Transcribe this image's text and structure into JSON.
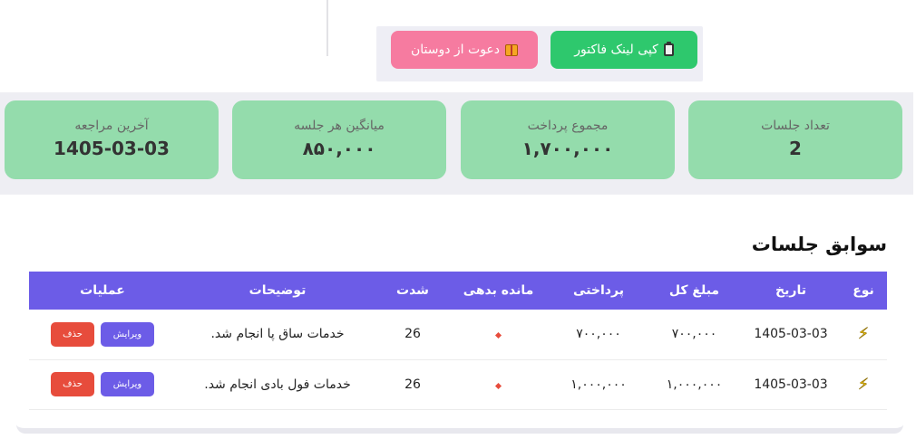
{
  "actions": {
    "copy_invoice_link": "کپی لینک فاکتور",
    "invite_friends": "دعوت از دوستان",
    "copy_icon": "clipboard-icon",
    "invite_icon": "gift-icon"
  },
  "stats": [
    {
      "label": "تعداد جلسات",
      "value": "2"
    },
    {
      "label": "مجموع پرداخت",
      "value": "۱,۷۰۰,۰۰۰"
    },
    {
      "label": "میانگین هر جلسه",
      "value": "۸۵۰,۰۰۰"
    },
    {
      "label": "آخرین مراجعه",
      "value": "1405-03-03"
    }
  ],
  "sessions": {
    "title": "سوابق جلسات",
    "columns": [
      "نوع",
      "تاریخ",
      "مبلغ کل",
      "پرداختی",
      "مانده بدهی",
      "شدت",
      "توضیحات",
      "عملیات"
    ],
    "rows": [
      {
        "type_icon": "lightning-icon",
        "date": "1405-03-03",
        "total": "۷۰۰,۰۰۰",
        "paid": "۷۰۰,۰۰۰",
        "debt": "•",
        "intensity": "26",
        "description": "خدمات ساق پا انجام شد.",
        "edit": "ویرایش",
        "delete": "حذف"
      },
      {
        "type_icon": "lightning-icon",
        "date": "1405-03-03",
        "total": "۱,۰۰۰,۰۰۰",
        "paid": "۱,۰۰۰,۰۰۰",
        "debt": "•",
        "intensity": "26",
        "description": "خدمات فول بادی انجام شد.",
        "edit": "ویرایش",
        "delete": "حذف"
      }
    ]
  },
  "colors": {
    "accent": "#6c5ce7",
    "success": "#2ec86d",
    "pink": "#f67ba0",
    "stat_bg": "#94dcac",
    "danger": "#e74c3c"
  }
}
